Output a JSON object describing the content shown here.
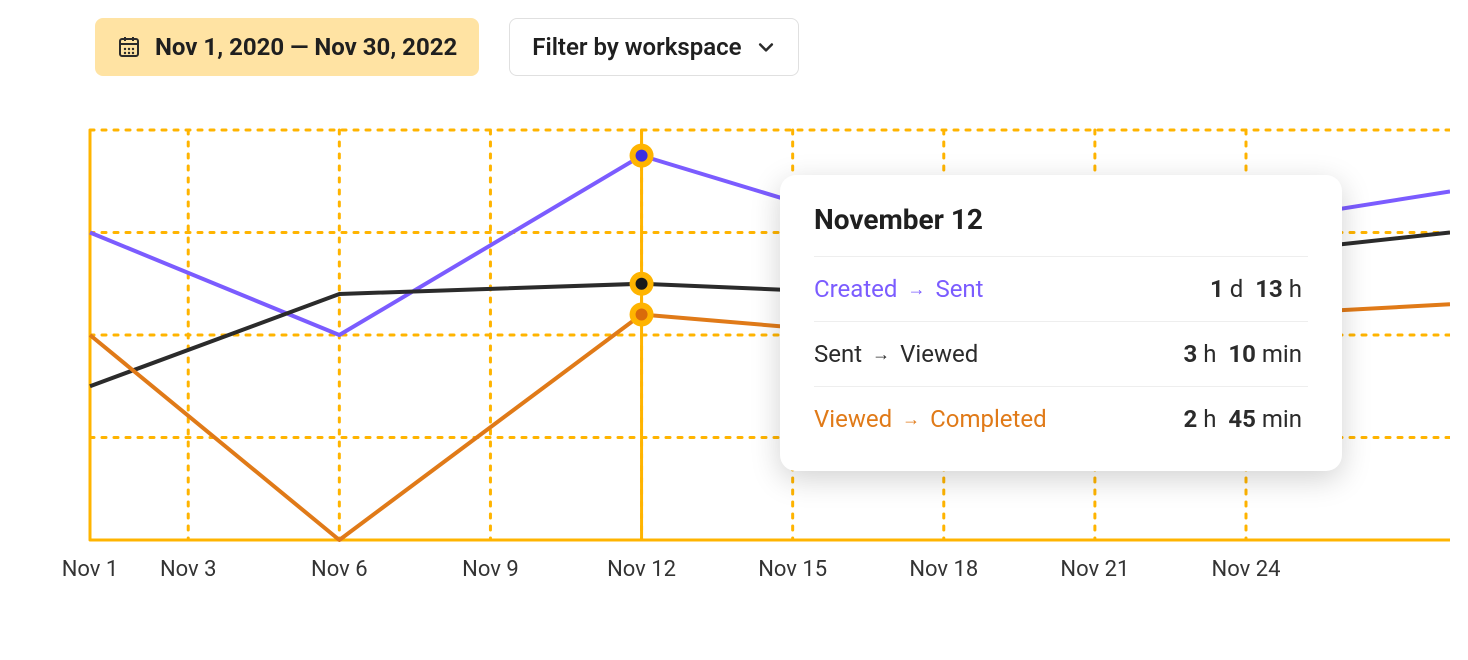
{
  "toolbar": {
    "date_range_label": "Nov 1, 2020 — Nov 30, 2022",
    "filter_label": "Filter by workspace"
  },
  "tooltip": {
    "title": "November 12",
    "rows": [
      {
        "from": "Created",
        "to": "Sent",
        "color": "purple",
        "v1_num": "1",
        "v1_unit": "d",
        "v2_num": "13",
        "v2_unit": "h"
      },
      {
        "from": "Sent",
        "to": "Viewed",
        "color": "black",
        "v1_num": "3",
        "v1_unit": "h",
        "v2_num": "10",
        "v2_unit": "min"
      },
      {
        "from": "Viewed",
        "to": "Completed",
        "color": "orange",
        "v1_num": "2",
        "v1_unit": "h",
        "v2_num": "45",
        "v2_unit": "min"
      }
    ]
  },
  "chart_data": {
    "type": "line",
    "x_tick_labels": [
      "Nov 1",
      "Nov 3",
      "Nov 6",
      "Nov 9",
      "Nov 12",
      "Nov 15",
      "Nov 18",
      "Nov 21",
      "Nov 24"
    ],
    "x_tick_positions": [
      0,
      1.3,
      3.3,
      5.3,
      7.3,
      9.3,
      11.3,
      13.3,
      15.3
    ],
    "x_range": [
      0,
      18
    ],
    "y_range": [
      0,
      4
    ],
    "y_gridlines": [
      0,
      1,
      2,
      3,
      4
    ],
    "highlight_x": 7.3,
    "series": [
      {
        "name": "Created → Sent",
        "color": "purple",
        "points": [
          [
            0,
            3.0
          ],
          [
            3.3,
            2.0
          ],
          [
            7.3,
            3.75
          ],
          [
            12.0,
            2.7
          ],
          [
            18,
            3.4
          ]
        ]
      },
      {
        "name": "Sent → Viewed",
        "color": "black",
        "points": [
          [
            0,
            1.5
          ],
          [
            3.3,
            2.4
          ],
          [
            7.3,
            2.5
          ],
          [
            10.5,
            2.4
          ],
          [
            18,
            3.0
          ]
        ]
      },
      {
        "name": "Viewed → Completed",
        "color": "orange",
        "points": [
          [
            0,
            2.0
          ],
          [
            3.3,
            0.0
          ],
          [
            7.3,
            2.2
          ],
          [
            10.5,
            2.0
          ],
          [
            18,
            2.3
          ]
        ]
      }
    ],
    "highlight_points": [
      {
        "series": "purple",
        "x": 7.3,
        "y": 3.75
      },
      {
        "series": "black",
        "x": 7.3,
        "y": 2.5
      },
      {
        "series": "orange",
        "x": 7.3,
        "y": 2.2
      }
    ]
  }
}
